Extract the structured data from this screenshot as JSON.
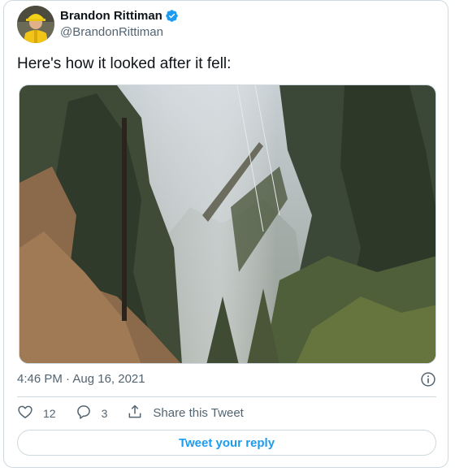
{
  "author": {
    "display_name": "Brandon Rittiman",
    "handle": "@BrandonRittiman",
    "verified": true
  },
  "tweet": {
    "text": "Here's how it looked after it fell:",
    "timestamp": "4:46 PM · Aug 16, 2021"
  },
  "actions": {
    "like_count": "12",
    "reply_count": "3",
    "share_label": "Share this Tweet"
  },
  "reply_button": {
    "label": "Tweet your reply"
  },
  "colors": {
    "accent": "#1d9bf0",
    "text_primary": "#0f1419",
    "text_secondary": "#536471",
    "border": "#cfd9de"
  },
  "icons": {
    "verified": "verified-badge-icon",
    "info": "info-icon",
    "like": "heart-icon",
    "reply": "reply-bubble-icon",
    "share": "share-icon"
  }
}
